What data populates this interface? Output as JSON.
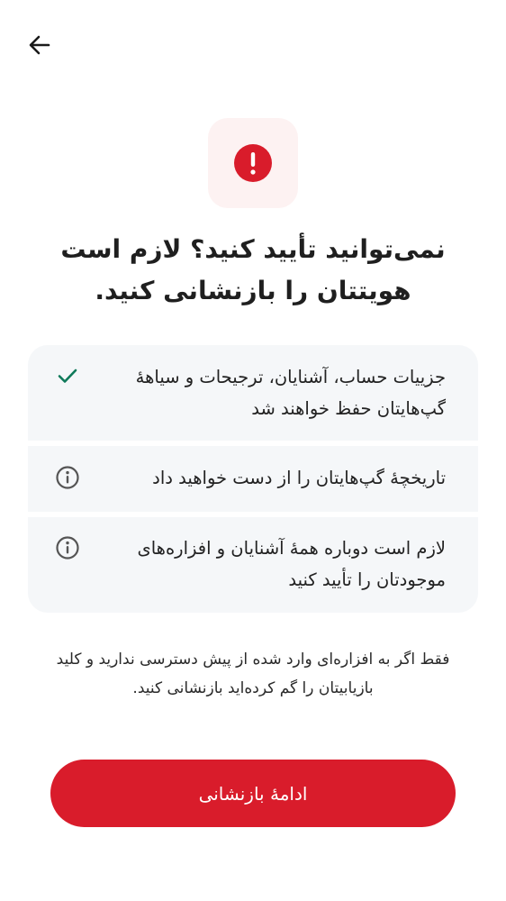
{
  "header": {
    "back_icon": "arrow-left-icon"
  },
  "alert": {
    "icon": "exclamation-circle-icon",
    "tile_color": "#fdf2f2",
    "icon_color": "#d91c2b"
  },
  "title": "نمی‌توانید تأیید کنید؟ لازم است هویتتان را بازنشانی کنید.",
  "info_items": [
    {
      "icon": "check-icon",
      "icon_color": "#0f7a5a",
      "text": "جزییات حساب، آشنایان، ترجیحات و سیاههٔ گپ‌هایتان حفظ خواهند شد"
    },
    {
      "icon": "info-circle-icon",
      "icon_color": "#555555",
      "text": "تاریخچهٔ گپ‌هایتان را از دست خواهید داد"
    },
    {
      "icon": "info-circle-icon",
      "icon_color": "#555555",
      "text": "لازم است دوباره همهٔ آشنایان و افزاره‌های موجودتان را تأیید کنید"
    }
  ],
  "footnote": "فقط اگر به افزاره‌ای وارد شده از پیش دسترسی ندارید و کلید بازیابیتان را گم کرده‌اید بازنشانی کنید.",
  "primary_button": {
    "label": "ادامهٔ بازنشانی",
    "color": "#d91c2b"
  }
}
